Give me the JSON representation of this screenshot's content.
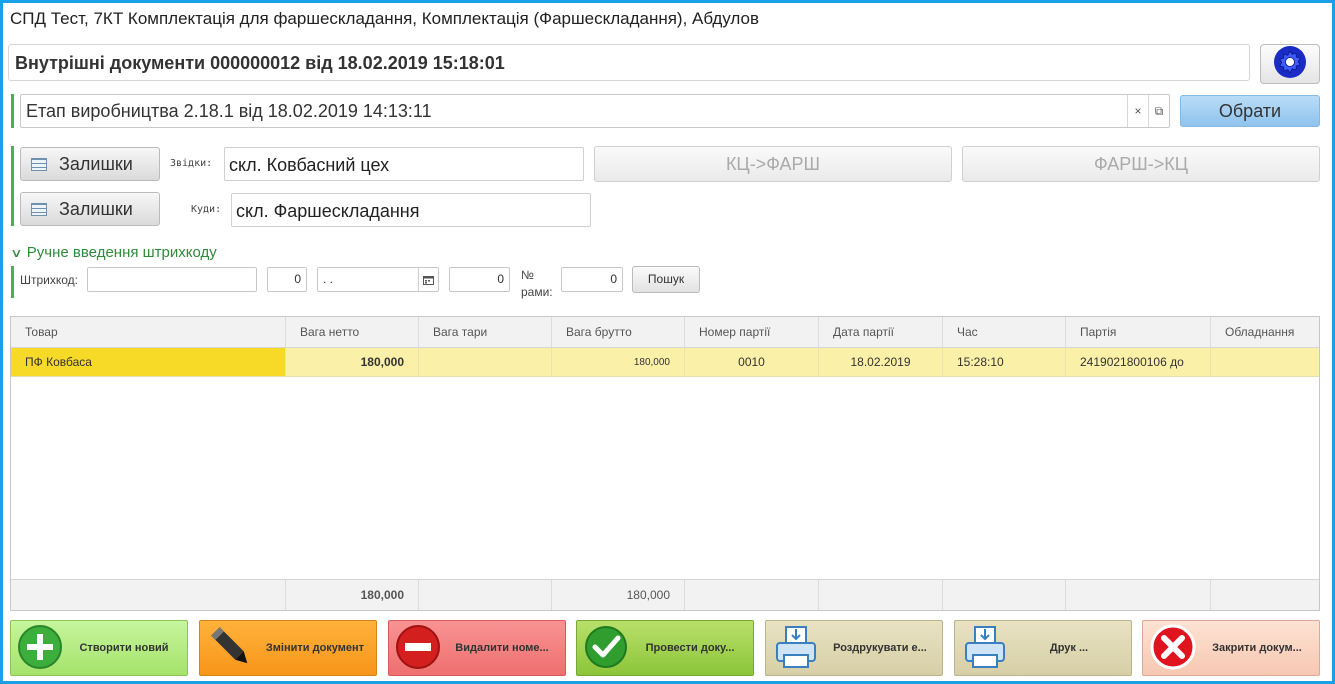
{
  "window": {
    "title": "СПД Тест, 7КТ Комплектація для фаршескладання, Комплектація (Фаршескладання), Абдулов"
  },
  "document": {
    "title": "Внутрішні документи 000000012 від 18.02.2019 15:18:01"
  },
  "stage": {
    "value": "Етап виробництва 2.18.1 від 18.02.2019 14:13:11",
    "clear_glyph": "×",
    "open_glyph": "⧉",
    "select_label": "Обрати"
  },
  "transfer": {
    "stock_label": "Залишки",
    "from_label": "Звідки:",
    "from_value": "скл. Ковбасний цех",
    "to_label": "Куди:",
    "to_value": "скл. Фаршескладання",
    "btn_kc_farsh": "КЦ->ФАРШ",
    "btn_farsh_kc": "ФАРШ->КЦ"
  },
  "barcode": {
    "section_label": "Ручне введення штрихкоду",
    "barcode_label": "Штрихкод:",
    "barcode_value": "",
    "qty_value": "0",
    "date_value": ". .",
    "num_value": "0",
    "frame_label_1": "№",
    "frame_label_2": "рами:",
    "frame_value": "0",
    "search_label": "Пошук"
  },
  "table": {
    "columns": [
      "Товар",
      "Вага нетто",
      "Вага тари",
      "Вага брутто",
      "Номер партії",
      "Дата партії",
      "Час",
      "Партія",
      "Обладнання"
    ],
    "rows": [
      [
        "ПФ Ковбаса",
        "180,000",
        "",
        "180,000",
        "0010",
        "18.02.2019",
        "15:28:10",
        "2419021800106 до",
        ""
      ]
    ],
    "totals": [
      "",
      "180,000",
      "",
      "180,000",
      "",
      "",
      "",
      "",
      ""
    ]
  },
  "toolbar": {
    "create": "Створити новий",
    "edit": "Змінити документ",
    "delete": "Видалити номе...",
    "post": "Провести доку...",
    "print_e": "Роздрукувати е...",
    "print": "Друк ...",
    "close": "Закрити докум..."
  },
  "colors": {
    "frame": "#1aa0e6",
    "section_green": "#2e8b3c",
    "selected_cell": "#f7d927",
    "selected_row": "#fbf0a8"
  }
}
